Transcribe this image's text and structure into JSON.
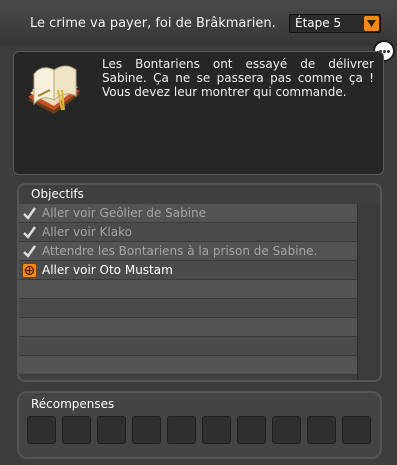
{
  "header": {
    "quest_title": "Le crime va payer, foi de Brâkmarien.",
    "step_selected": "Étape 5"
  },
  "description": {
    "text": "Les Bontariens ont essayé de délivrer Sabine. Ça ne se passera pas comme ça ! Vous devez leur montrer qui commande.",
    "icon": "book-icon"
  },
  "objectives": {
    "title": "Objectifs",
    "items": [
      {
        "label": "Aller voir Geôlier de Sabine",
        "status": "done",
        "icon": "checkmark-icon"
      },
      {
        "label": "Aller voir Klako",
        "status": "done",
        "icon": "checkmark-icon"
      },
      {
        "label": "Attendre les Bontariens à la prison de Sabine.",
        "status": "done",
        "icon": "checkmark-icon"
      },
      {
        "label": "Aller voir Oto Mustam",
        "status": "active",
        "icon": "target-icon"
      }
    ],
    "empty_rows": 5
  },
  "rewards": {
    "title": "Récompenses",
    "slot_count": 10
  },
  "colors": {
    "accent": "#f18a1b",
    "done_text": "#a5a5a5"
  }
}
